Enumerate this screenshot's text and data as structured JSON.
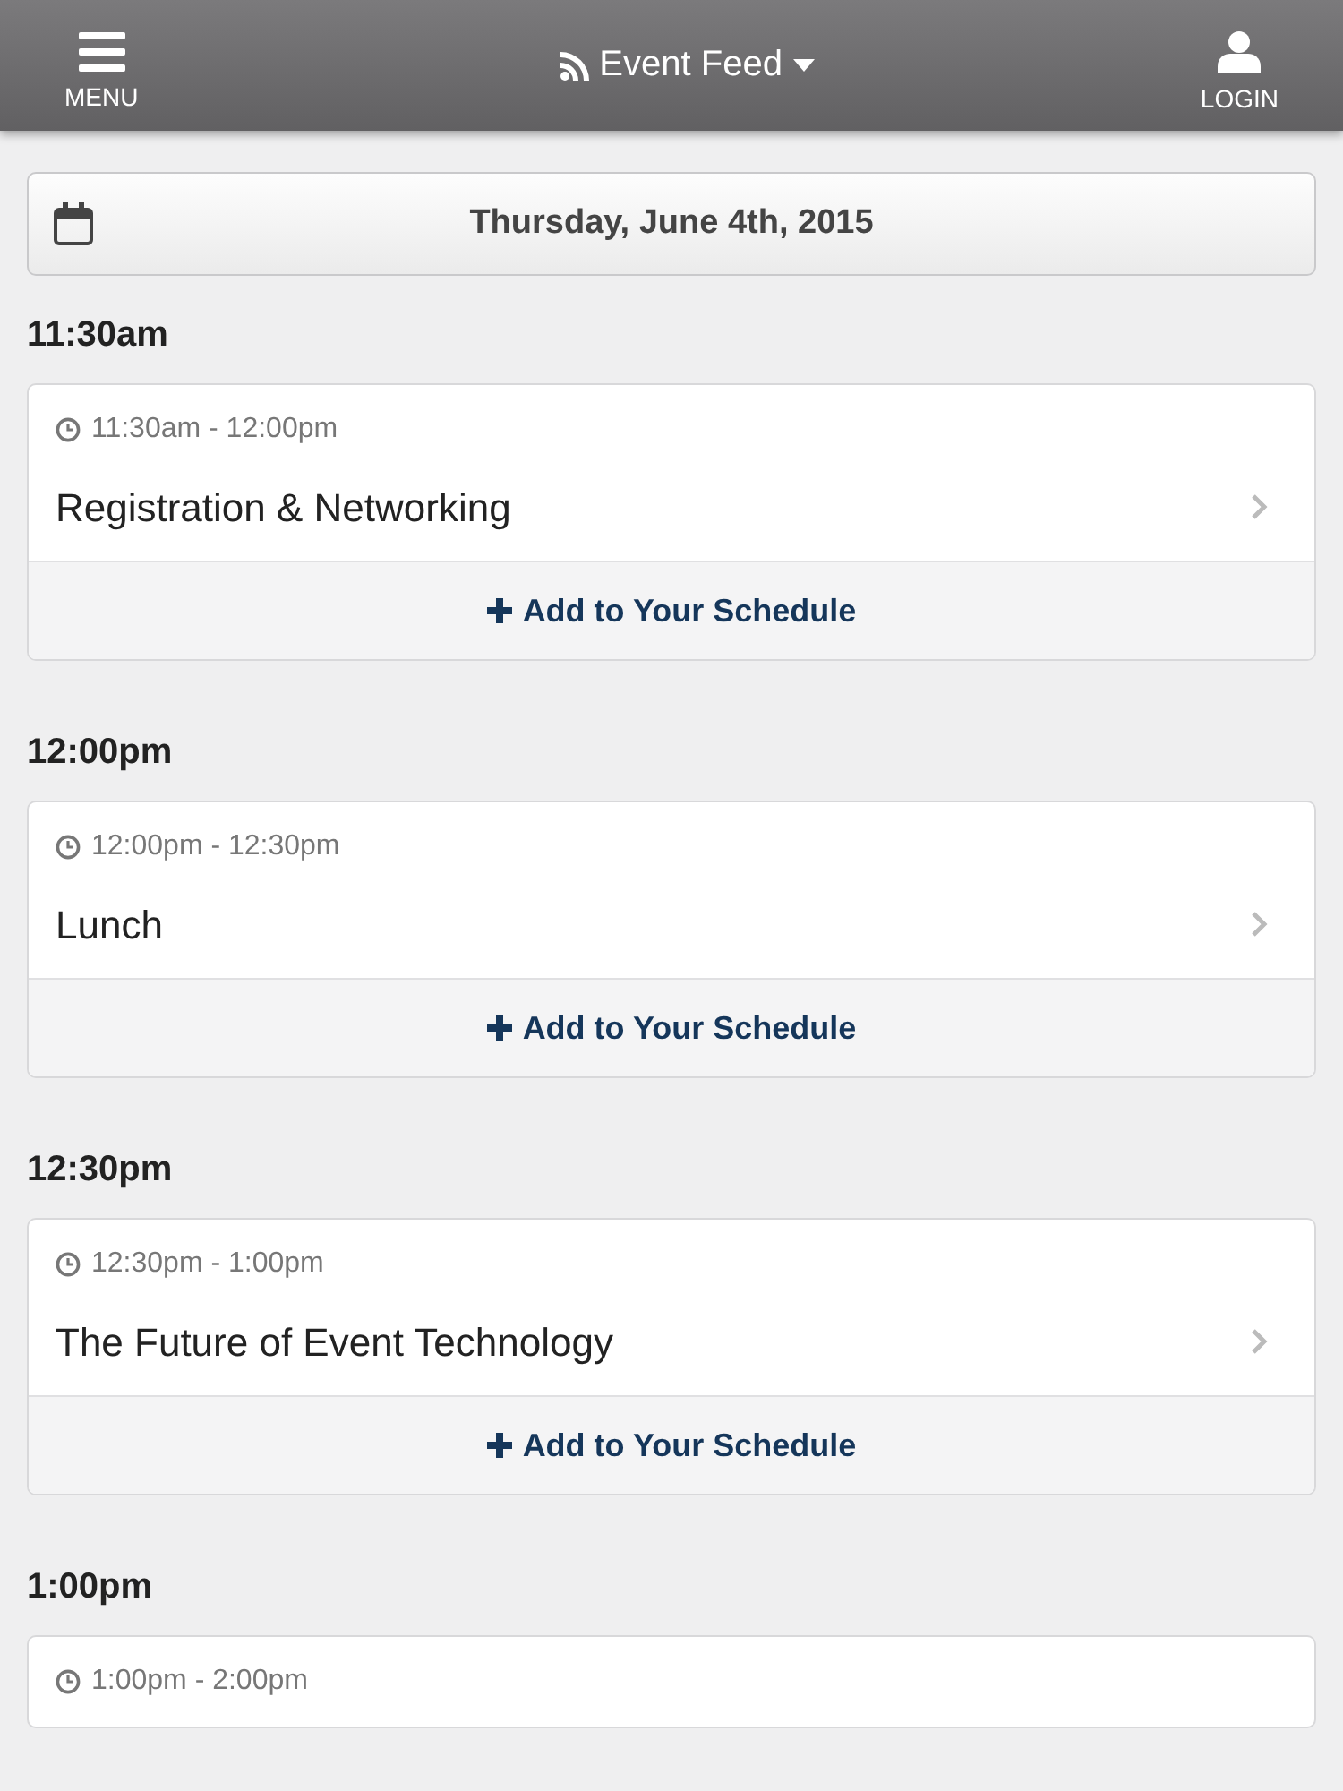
{
  "header": {
    "menu_label": "MENU",
    "title": "Event Feed",
    "login_label": "LOGIN"
  },
  "date_button": {
    "label": "Thursday, June 4th, 2015"
  },
  "groups": [
    {
      "heading": "11:30am",
      "sessions": [
        {
          "time": "11:30am - 12:00pm",
          "title": "Registration & Networking",
          "action": "Add to Your Schedule"
        }
      ]
    },
    {
      "heading": "12:00pm",
      "sessions": [
        {
          "time": "12:00pm - 12:30pm",
          "title": "Lunch",
          "action": "Add to Your Schedule"
        }
      ]
    },
    {
      "heading": "12:30pm",
      "sessions": [
        {
          "time": "12:30pm - 1:00pm",
          "title": "The Future of Event Technology",
          "action": "Add to Your Schedule"
        }
      ]
    },
    {
      "heading": "1:00pm",
      "sessions": [
        {
          "time": "1:00pm - 2:00pm"
        }
      ]
    }
  ]
}
